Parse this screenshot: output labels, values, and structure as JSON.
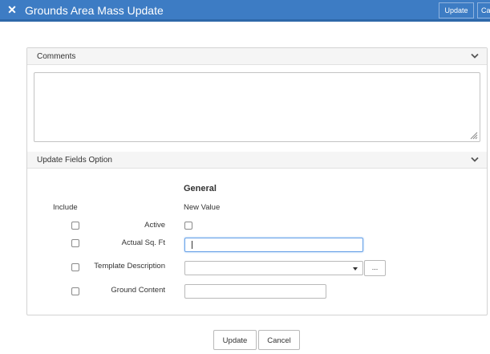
{
  "header": {
    "close_icon": "close-x-icon",
    "title": "Grounds Area Mass Update",
    "update_label": "Update",
    "cancel_label": "Cancel"
  },
  "comments_section": {
    "title": "Comments",
    "icon": "chevron-down-icon",
    "value": ""
  },
  "update_section": {
    "title": "Update Fields Option",
    "icon": "chevron-down-icon",
    "group_heading": "General",
    "include_header": "Include",
    "new_value_header": "New Value",
    "rows": [
      {
        "label": "Active",
        "include_checked": false,
        "value_type": "checkbox",
        "value_checked": false
      },
      {
        "label": "Actual Sq. Ft",
        "include_checked": false,
        "value_type": "text",
        "value": ""
      },
      {
        "label": "Template Description",
        "include_checked": false,
        "value_type": "select",
        "value": "",
        "lookup_label": "..."
      },
      {
        "label": "Ground Content",
        "include_checked": false,
        "value_type": "text",
        "value": ""
      }
    ]
  },
  "footer": {
    "update_label": "Update",
    "cancel_label": "Cancel"
  },
  "colors": {
    "titlebar_bg": "#3d7cc4",
    "focus_border": "#6aa3e8",
    "section_header_bg": "#f5f5f5"
  }
}
